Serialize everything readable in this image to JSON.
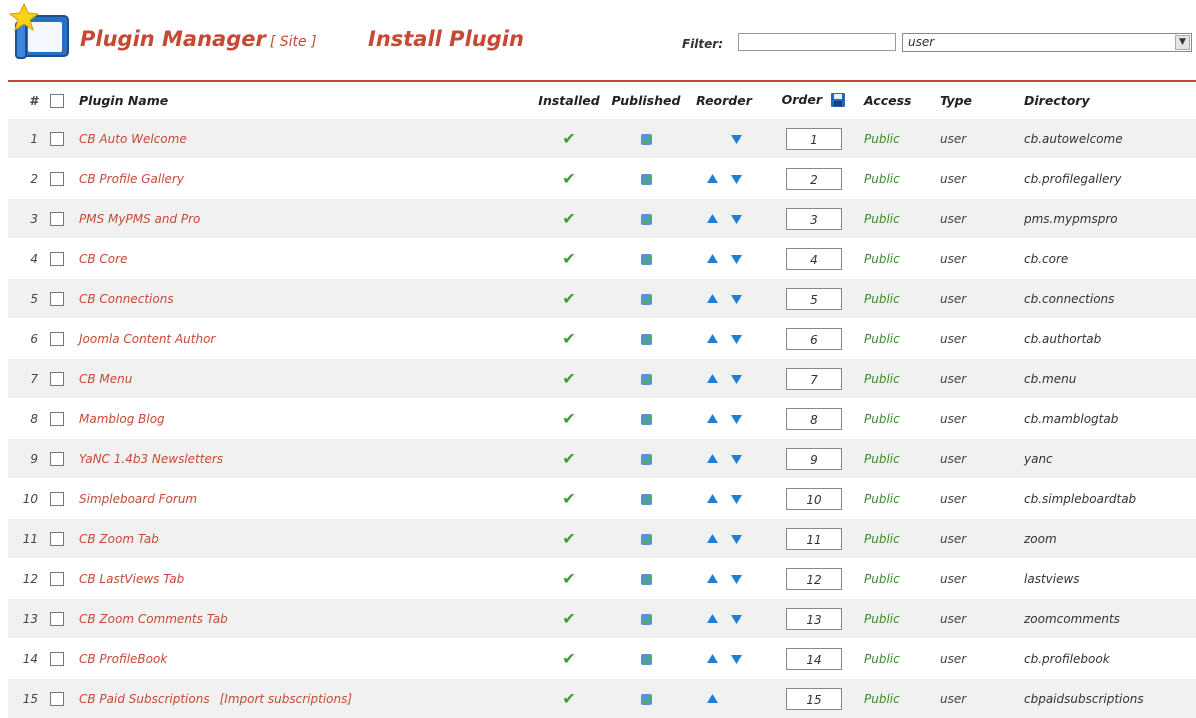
{
  "header": {
    "title": "Plugin Manager",
    "site_tag": "[ Site ]",
    "install_link": "Install Plugin",
    "filter_label": "Filter:",
    "filter_value": "",
    "type_select_value": "user"
  },
  "columns": [
    "#",
    "Plugin Name",
    "Installed",
    "Published",
    "Reorder",
    "Order",
    "Access",
    "Type",
    "Directory"
  ],
  "rows": [
    {
      "num": "1",
      "name": "CB Auto Welcome",
      "order": "1",
      "access": "Public",
      "type": "user",
      "directory": "cb.autowelcome",
      "up": false,
      "down": true,
      "extra": ""
    },
    {
      "num": "2",
      "name": "CB Profile Gallery",
      "order": "2",
      "access": "Public",
      "type": "user",
      "directory": "cb.profilegallery",
      "up": true,
      "down": true,
      "extra": ""
    },
    {
      "num": "3",
      "name": "PMS MyPMS and Pro",
      "order": "3",
      "access": "Public",
      "type": "user",
      "directory": "pms.mypmspro",
      "up": true,
      "down": true,
      "extra": ""
    },
    {
      "num": "4",
      "name": "CB Core",
      "order": "4",
      "access": "Public",
      "type": "user",
      "directory": "cb.core",
      "up": true,
      "down": true,
      "extra": ""
    },
    {
      "num": "5",
      "name": "CB Connections",
      "order": "5",
      "access": "Public",
      "type": "user",
      "directory": "cb.connections",
      "up": true,
      "down": true,
      "extra": ""
    },
    {
      "num": "6",
      "name": "Joomla Content Author",
      "order": "6",
      "access": "Public",
      "type": "user",
      "directory": "cb.authortab",
      "up": true,
      "down": true,
      "extra": ""
    },
    {
      "num": "7",
      "name": "CB Menu",
      "order": "7",
      "access": "Public",
      "type": "user",
      "directory": "cb.menu",
      "up": true,
      "down": true,
      "extra": ""
    },
    {
      "num": "8",
      "name": "Mamblog Blog",
      "order": "8",
      "access": "Public",
      "type": "user",
      "directory": "cb.mamblogtab",
      "up": true,
      "down": true,
      "extra": ""
    },
    {
      "num": "9",
      "name": "YaNC 1.4b3 Newsletters",
      "order": "9",
      "access": "Public",
      "type": "user",
      "directory": "yanc",
      "up": true,
      "down": true,
      "extra": ""
    },
    {
      "num": "10",
      "name": "Simpleboard Forum",
      "order": "10",
      "access": "Public",
      "type": "user",
      "directory": "cb.simpleboardtab",
      "up": true,
      "down": true,
      "extra": ""
    },
    {
      "num": "11",
      "name": "CB Zoom Tab",
      "order": "11",
      "access": "Public",
      "type": "user",
      "directory": "zoom",
      "up": true,
      "down": true,
      "extra": ""
    },
    {
      "num": "12",
      "name": "CB LastViews Tab",
      "order": "12",
      "access": "Public",
      "type": "user",
      "directory": "lastviews",
      "up": true,
      "down": true,
      "extra": ""
    },
    {
      "num": "13",
      "name": "CB Zoom Comments Tab",
      "order": "13",
      "access": "Public",
      "type": "user",
      "directory": "zoomcomments",
      "up": true,
      "down": true,
      "extra": ""
    },
    {
      "num": "14",
      "name": "CB ProfileBook",
      "order": "14",
      "access": "Public",
      "type": "user",
      "directory": "cb.profilebook",
      "up": true,
      "down": true,
      "extra": ""
    },
    {
      "num": "15",
      "name": "CB Paid Subscriptions",
      "order": "15",
      "access": "Public",
      "type": "user",
      "directory": "cbpaidsubscriptions",
      "up": true,
      "down": false,
      "extra": "[Import subscriptions]"
    }
  ],
  "colors": {
    "brand": "#c64934",
    "access": "#3a8a2a",
    "row_alt": "#f1f1f1"
  }
}
